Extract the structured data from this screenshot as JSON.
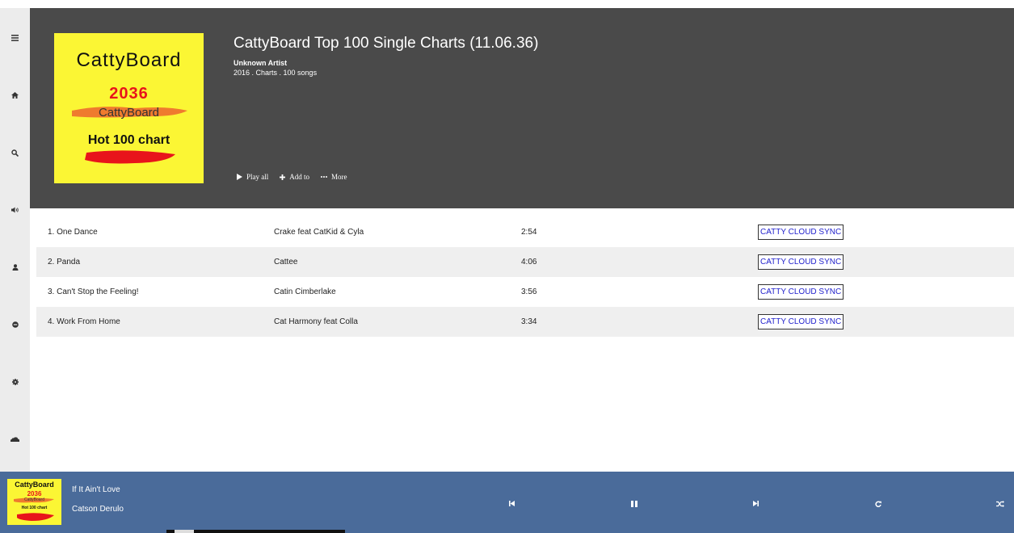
{
  "sidebar": {
    "icons": [
      "menu-icon",
      "home-icon",
      "search-icon",
      "volume-icon",
      "user-icon",
      "disc-icon",
      "gear-icon",
      "cloud-icon"
    ]
  },
  "album": {
    "cover": {
      "line1": "CattyBoard",
      "line2": "2036",
      "line3": "CattyBoard",
      "line4": "Hot 100 chart"
    },
    "title": "CattyBoard Top 100 Single Charts (11.06.36)",
    "artist": "Unknown Artist",
    "meta": "2016 . Charts . 100 songs",
    "actions": {
      "play_all": "Play all",
      "add_to": "Add to",
      "more": "More"
    }
  },
  "tracks": [
    {
      "title": "1. One Dance",
      "artist": "Crake feat CatKid & Cyla",
      "duration": "2:54",
      "sync": "CATTY CLOUD SYNC"
    },
    {
      "title": "2. Panda",
      "artist": "Cattee",
      "duration": "4:06",
      "sync": "CATTY CLOUD SYNC"
    },
    {
      "title": "3. Can't Stop the Feeling!",
      "artist": "Catin Cimberlake",
      "duration": "3:56",
      "sync": "CATTY CLOUD SYNC"
    },
    {
      "title": "4. Work From Home",
      "artist": "Cat Harmony feat Colla",
      "duration": "3:34",
      "sync": "CATTY CLOUD SYNC"
    }
  ],
  "player": {
    "cover": {
      "line1": "CattyBoard",
      "line2": "2036",
      "line3": "CattyBoard",
      "line4": "Hot 100 chart"
    },
    "now_playing_title": "If It Ain't Love",
    "now_playing_artist": "Catson Derulo",
    "controls": [
      "previous-icon",
      "pause-icon",
      "next-icon",
      "repeat-icon",
      "shuffle-icon"
    ]
  },
  "colors": {
    "header_bg": "#4a4a4a",
    "player_bg": "#4a6b9a",
    "cover_yellow": "#fbf634",
    "cover_red": "#e8141b",
    "sync_link": "#2222cc"
  }
}
